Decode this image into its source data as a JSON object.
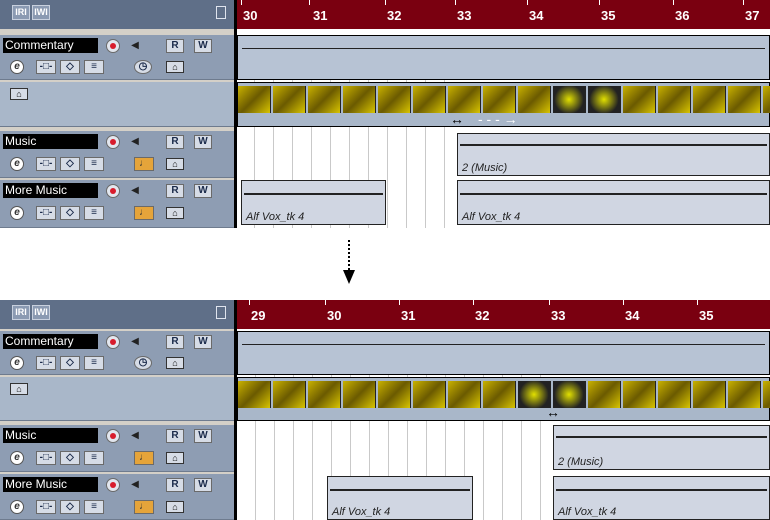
{
  "header": {
    "r_button": "IRI",
    "w_button": "IWI"
  },
  "top": {
    "ruler": [
      "30",
      "31",
      "32",
      "33",
      "34",
      "35",
      "36",
      "37"
    ],
    "tracks": [
      {
        "name": "Commentary",
        "r": "R",
        "w": "W"
      },
      {
        "name": "Music",
        "r": "R",
        "w": "W",
        "event": "2 (Music)"
      },
      {
        "name": "More Music",
        "r": "R",
        "w": "W",
        "event_left": "Alf Vox_tk 4",
        "event_right": "Alf Vox_tk 4"
      }
    ],
    "move_cursor": "↔",
    "drag_arrow": "- - - →"
  },
  "bottom": {
    "ruler": [
      "29",
      "30",
      "31",
      "32",
      "33",
      "34",
      "35"
    ],
    "tracks": [
      {
        "name": "Commentary",
        "r": "R",
        "w": "W"
      },
      {
        "name": "Music",
        "r": "R",
        "w": "W",
        "event": "2 (Music)"
      },
      {
        "name": "More Music",
        "r": "R",
        "w": "W",
        "event_left": "Alf Vox_tk 4",
        "event_right": "Alf Vox_tk 4"
      }
    ],
    "move_cursor": "↔"
  },
  "icons": {
    "edit": "e",
    "record": "record-icon",
    "monitor": "speaker-icon",
    "lock": "lock-icon",
    "clock": "clock-icon",
    "note": "note-icon"
  },
  "colors": {
    "ruler": "#7a0010",
    "header": "#5f6f88",
    "track": "#a9b7c9",
    "record": "#d81c2c",
    "note": "#e5a43a"
  }
}
